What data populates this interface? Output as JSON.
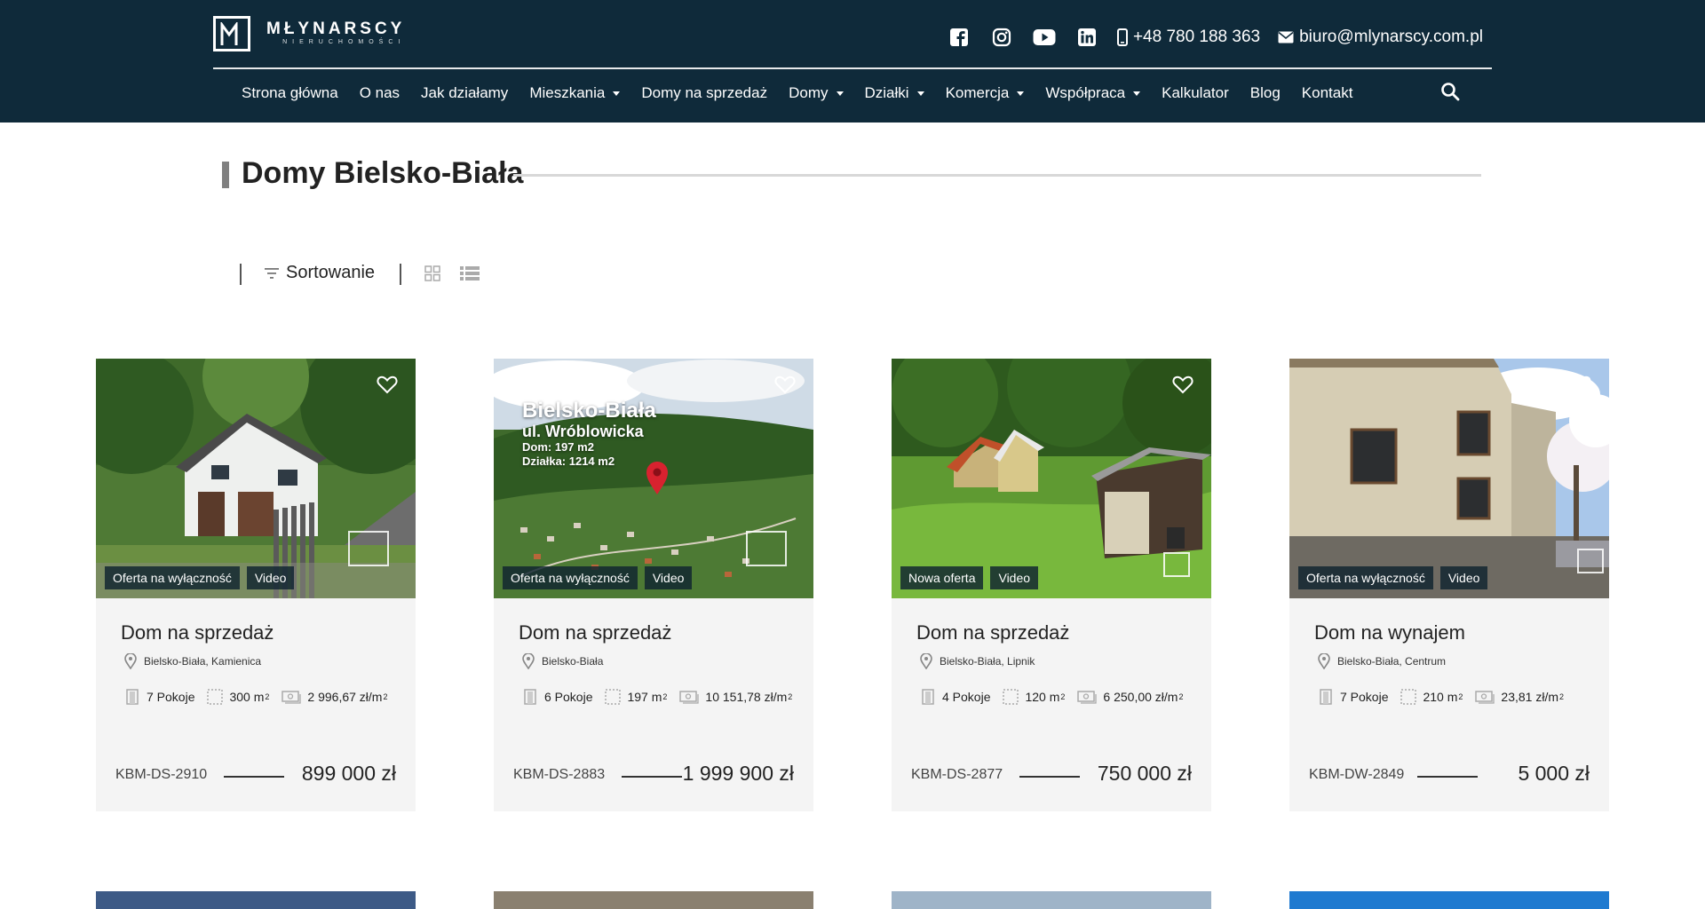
{
  "brand": {
    "name": "MŁYNARSCY",
    "tagline": "NIERUCHOMOŚCI"
  },
  "contact": {
    "phone": "+48 780 188 363",
    "email": "biuro@mlynarscy.com.pl"
  },
  "social": [
    "facebook-icon",
    "instagram-icon",
    "youtube-icon",
    "linkedin-icon"
  ],
  "nav": {
    "items": [
      {
        "label": "Strona główna",
        "dropdown": false
      },
      {
        "label": "O nas",
        "dropdown": false
      },
      {
        "label": "Jak działamy",
        "dropdown": false
      },
      {
        "label": "Mieszkania",
        "dropdown": true
      },
      {
        "label": "Domy na sprzedaż",
        "dropdown": false
      },
      {
        "label": "Domy",
        "dropdown": true
      },
      {
        "label": "Działki",
        "dropdown": true
      },
      {
        "label": "Komercja",
        "dropdown": true
      },
      {
        "label": "Współpraca",
        "dropdown": true
      },
      {
        "label": "Kalkulator",
        "dropdown": false
      },
      {
        "label": "Blog",
        "dropdown": false
      },
      {
        "label": "Kontakt",
        "dropdown": false
      }
    ]
  },
  "page": {
    "title_prefix": "Domy",
    "title_main": "Bielsko-Biała"
  },
  "toolbar": {
    "sort_label": "Sortowanie"
  },
  "listings": [
    {
      "badges": [
        "Oferta na wyłączność",
        "Video"
      ],
      "title": "Dom na sprzedaż",
      "location": "Bielsko-Biała, Kamienica",
      "rooms": "7 Pokoje",
      "area": "300 m",
      "price_per_m": "2 996,67 zł/m",
      "code": "KBM-DS-2910",
      "price": "899 000 zł"
    },
    {
      "badges": [
        "Oferta na wyłączność",
        "Video"
      ],
      "title": "Dom na sprzedaż",
      "location": "Bielsko-Biała",
      "rooms": "6 Pokoje",
      "area": "197 m",
      "price_per_m": "10 151,78 zł/m",
      "code": "KBM-DS-2883",
      "price": "1 999 900 zł",
      "photo_text": [
        "Bielsko-Biała",
        "ul. Wróblowicka",
        "Dom: 197 m2",
        "Działka: 1214 m2"
      ]
    },
    {
      "badges": [
        "Nowa oferta",
        "Video"
      ],
      "title": "Dom na sprzedaż",
      "location": "Bielsko-Biała, Lipnik",
      "rooms": "4 Pokoje",
      "area": "120 m",
      "price_per_m": "6 250,00 zł/m",
      "code": "KBM-DS-2877",
      "price": "750 000 zł"
    },
    {
      "badges": [
        "Oferta na wyłączność",
        "Video"
      ],
      "title": "Dom na wynajem",
      "location": "Bielsko-Biała, Centrum",
      "rooms": "7 Pokoje",
      "area": "210 m",
      "price_per_m": "23,81 zł/m",
      "code": "KBM-DW-2849",
      "price": "5 000 zł"
    }
  ],
  "colors": {
    "header_bg": "#0f2a3a",
    "card_bg": "#f4f4f4",
    "badge_bg": "#0f2330"
  }
}
